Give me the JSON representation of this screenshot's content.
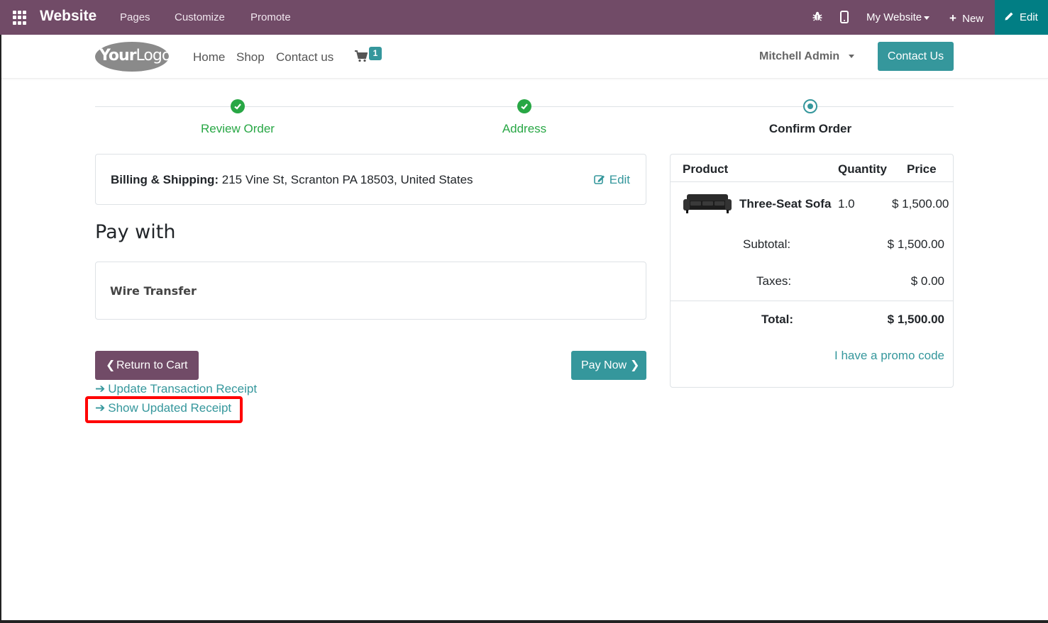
{
  "topbar": {
    "brand": "Website",
    "menus": [
      "Pages",
      "Customize",
      "Promote"
    ],
    "my_website": "My Website",
    "new_label": "New",
    "edit_label": "Edit"
  },
  "header": {
    "logo_bold": "Your",
    "logo_rest": "Logo",
    "nav": [
      "Home",
      "Shop",
      "Contact us"
    ],
    "cart_count": "1",
    "user": "Mitchell Admin",
    "contact_button": "Contact Us"
  },
  "wizard": {
    "steps": [
      {
        "label": "Review Order",
        "state": "done"
      },
      {
        "label": "Address",
        "state": "done"
      },
      {
        "label": "Confirm Order",
        "state": "current"
      }
    ]
  },
  "billing": {
    "label": "Billing & Shipping:",
    "address": " 215 Vine St, Scranton PA 18503, United States",
    "edit_label": "Edit"
  },
  "payment": {
    "heading": "Pay with",
    "method": "Wire Transfer",
    "return_label": "Return to Cart",
    "pay_label": "Pay Now",
    "link_update": "Update Transaction Receipt",
    "link_show": "Show Updated Receipt"
  },
  "summary": {
    "columns": [
      "Product",
      "Quantity",
      "Price"
    ],
    "line": {
      "product": "Three-Seat Sofa",
      "quantity": "1.0",
      "price": "$ 1,500.00"
    },
    "subtotal_label": "Subtotal:",
    "subtotal": "$ 1,500.00",
    "taxes_label": "Taxes:",
    "taxes": "$ 0.00",
    "total_label": "Total:",
    "total": "$ 1,500.00",
    "promo": "I have a promo code"
  },
  "colors": {
    "topbar": "#714b67",
    "accent": "#35979c",
    "edit_bg": "#017e84",
    "success": "#28a745",
    "highlight": "#ff0000"
  }
}
